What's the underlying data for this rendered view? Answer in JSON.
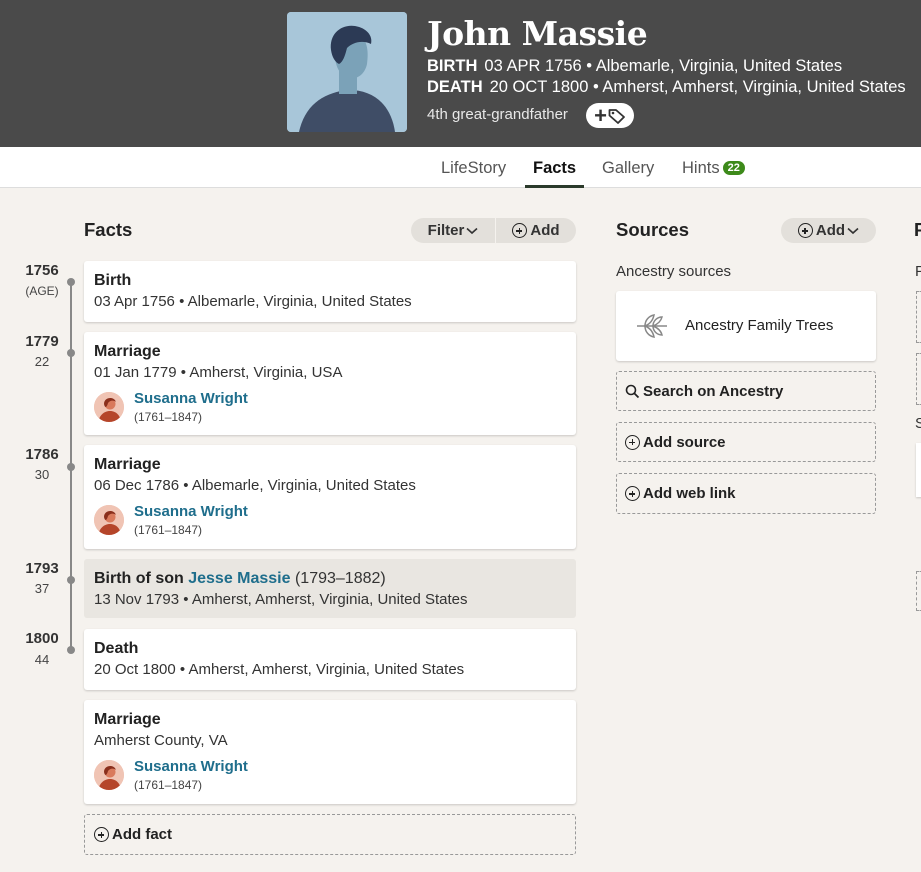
{
  "person": {
    "name": "John Massie",
    "birth_label": "BIRTH",
    "birth_value": "03 APR 1756 • Albemarle, Virginia, United States",
    "death_label": "DEATH",
    "death_value": "20 OCT 1800 • Amherst, Amherst, Virginia, United States",
    "relation": "4th great-grandfather",
    "tag_button": "+"
  },
  "tabs": [
    {
      "label": "LifeStory",
      "active": false
    },
    {
      "label": "Facts",
      "active": true
    },
    {
      "label": "Gallery",
      "active": false
    },
    {
      "label": "Hints",
      "active": false,
      "badge": "22"
    }
  ],
  "facts": {
    "title": "Facts",
    "filter_label": "Filter",
    "add_label": "Add",
    "add_fact_label": "Add fact",
    "timeline": [
      {
        "year": "1756",
        "age": "(AGE)"
      },
      {
        "year": "1779",
        "age": "22"
      },
      {
        "year": "1786",
        "age": "30"
      },
      {
        "year": "1793",
        "age": "37"
      },
      {
        "year": "1800",
        "age": "44"
      }
    ],
    "items": [
      {
        "title": "Birth",
        "detail": "03 Apr 1756 • Albemarle, Virginia, United States"
      },
      {
        "title": "Marriage",
        "detail": "01 Jan 1779 • Amherst, Virginia, USA",
        "spouse": "Susanna Wright",
        "spouse_years": "(1761–1847)"
      },
      {
        "title": "Marriage",
        "detail": "06 Dec 1786 • Albemarle, Virginia, United States",
        "spouse": "Susanna Wright",
        "spouse_years": "(1761–1847)"
      },
      {
        "title_prefix": "Birth of son ",
        "title_link": "Jesse Massie",
        "title_years": " (1793–1882)",
        "detail": "13 Nov 1793 • Amherst, Amherst, Virginia, United States"
      },
      {
        "title": "Death",
        "detail": "20 Oct 1800 • Amherst, Amherst, Virginia, United States"
      },
      {
        "title": "Marriage",
        "detail": "Amherst County, VA",
        "spouse": "Susanna Wright",
        "spouse_years": "(1761–1847)"
      }
    ]
  },
  "sources": {
    "title": "Sources",
    "add_label": "Add",
    "group_label": "Ancestry sources",
    "card_label": "Ancestry Family Trees",
    "search_label": "Search on Ancestry",
    "add_source_label": "Add source",
    "add_web_link_label": "Add web link"
  },
  "clipped_column": {
    "title_letter": "F",
    "letter_p": "P",
    "letter_s": "S"
  },
  "colors": {
    "header_bg": "#4a4a4a",
    "page_bg": "#f5f2ee",
    "link": "#1f6e8c",
    "badge": "#3d8a1a"
  }
}
